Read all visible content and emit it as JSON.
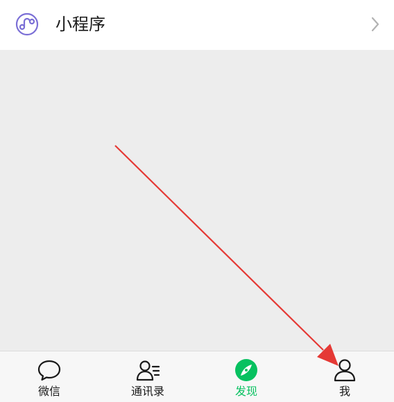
{
  "row": {
    "label": "小程序",
    "icon": "mini-program-icon",
    "chevron": "chevron-right-icon"
  },
  "tabbar": {
    "tabs": [
      {
        "label": "微信",
        "icon": "chat-bubble-icon",
        "active": false
      },
      {
        "label": "通讯录",
        "icon": "contacts-icon",
        "active": false
      },
      {
        "label": "发现",
        "icon": "compass-icon",
        "active": true
      },
      {
        "label": "我",
        "icon": "person-icon",
        "active": false
      }
    ]
  },
  "colors": {
    "accent": "#07c160",
    "annotation_arrow": "#e53935",
    "mini_program_icon": "#7b6fd6"
  }
}
